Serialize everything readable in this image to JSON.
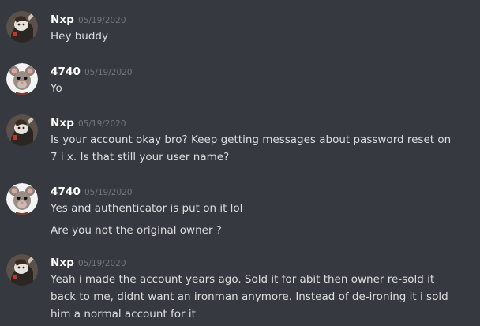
{
  "messages": [
    {
      "username": "Nxp",
      "avatar": "nxp-avatar",
      "timestamp": "05/19/2020",
      "lines": [
        "Hey buddy"
      ]
    },
    {
      "username": "4740",
      "avatar": "rat-avatar",
      "timestamp": "05/19/2020",
      "lines": [
        "Yo"
      ]
    },
    {
      "username": "Nxp",
      "avatar": "nxp-avatar",
      "timestamp": "05/19/2020",
      "lines": [
        "Is your account okay bro? Keep getting messages about password reset on 7 i x. Is that still your user name?"
      ]
    },
    {
      "username": "4740",
      "avatar": "rat-avatar",
      "timestamp": "05/19/2020",
      "lines": [
        "Yes and authenticator is put on it lol",
        "Are you not the original owner ?"
      ]
    },
    {
      "username": "Nxp",
      "avatar": "nxp-avatar",
      "timestamp": "05/19/2020",
      "lines": [
        "Yeah i made the account years ago. Sold it for abit then owner re-sold it back to me, didnt want an ironman anymore. Instead of de-ironing it i sold him a normal account for it"
      ]
    }
  ],
  "colors": {
    "background": "#36393f",
    "username": "#ffffff",
    "timestamp": "#72767d",
    "message_text": "#dcddde"
  }
}
